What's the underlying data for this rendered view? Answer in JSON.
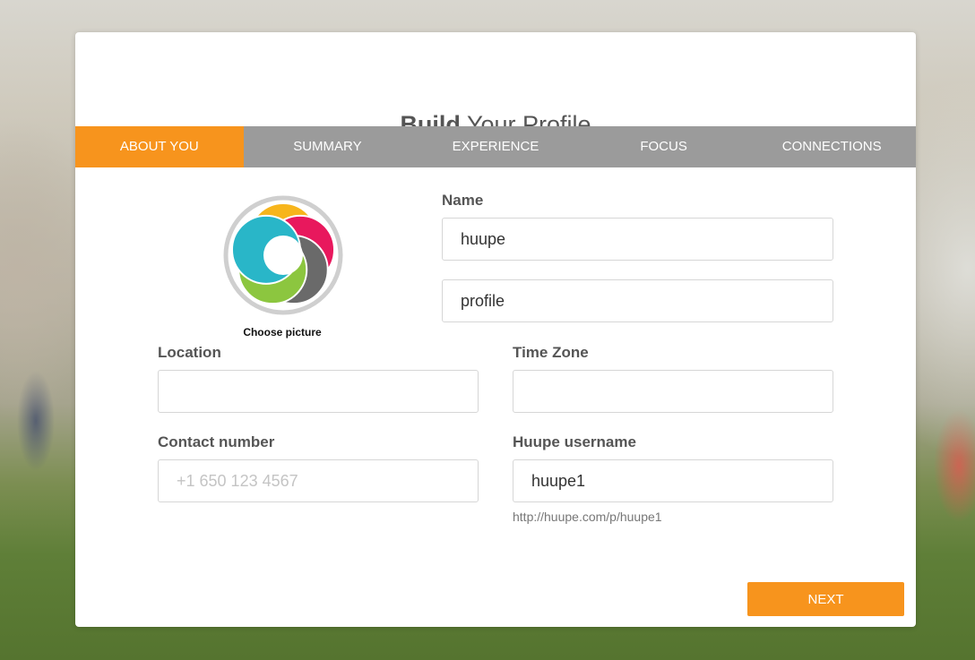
{
  "title": {
    "bold": "Build",
    "rest": " Your Profile"
  },
  "tabs": [
    {
      "label": "ABOUT YOU",
      "active": true
    },
    {
      "label": "SUMMARY",
      "active": false
    },
    {
      "label": "EXPERIENCE",
      "active": false
    },
    {
      "label": "FOCUS",
      "active": false
    },
    {
      "label": "CONNECTIONS",
      "active": false
    }
  ],
  "avatar": {
    "icon": "huupe-logo-icon",
    "choose_label": "Choose picture",
    "colors": [
      "#f7b51c",
      "#e8185d",
      "#6a6a6a",
      "#8cc63f",
      "#29b6c8"
    ]
  },
  "form": {
    "name_label": "Name",
    "first_name_value": "huupe",
    "last_name_value": "profile",
    "location_label": "Location",
    "location_value": "",
    "timezone_label": "Time Zone",
    "timezone_value": "",
    "contact_label": "Contact number",
    "contact_value": "",
    "contact_placeholder": "+1 650 123 4567",
    "username_label": "Huupe username",
    "username_value": "huupe1",
    "profile_url": "http://huupe.com/p/huupe1"
  },
  "next_label": "NEXT",
  "colors": {
    "accent": "#f7941d",
    "tab_bar": "#9b9b9b",
    "label_text": "#555555"
  }
}
